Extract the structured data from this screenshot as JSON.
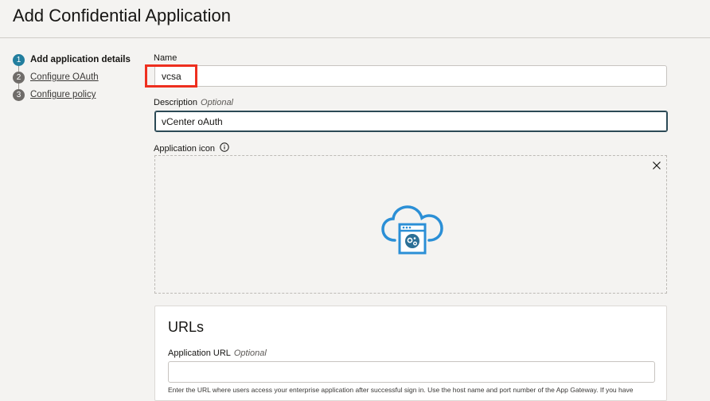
{
  "page": {
    "title": "Add Confidential Application"
  },
  "steps": [
    {
      "number": "1",
      "label": "Add application details",
      "active": true
    },
    {
      "number": "2",
      "label": "Configure OAuth",
      "active": false
    },
    {
      "number": "3",
      "label": "Configure policy",
      "active": false
    }
  ],
  "form": {
    "name": {
      "label": "Name",
      "value": "vcsa"
    },
    "description": {
      "label": "Description",
      "optional": "Optional",
      "value": "vCenter oAuth"
    },
    "application_icon": {
      "label": "Application icon"
    }
  },
  "urls": {
    "title": "URLs",
    "application_url": {
      "label": "Application URL",
      "optional": "Optional",
      "value": ""
    },
    "help_text": "Enter the URL where users access your enterprise application after successful sign in. Use the host name and port number of the App Gateway. If you have"
  },
  "colors": {
    "accent": "#227e9e",
    "highlight": "#ee2f1f",
    "icon_blue": "#2b8fd6"
  },
  "icons": {
    "info": "info-icon",
    "close": "close-icon",
    "app_icon": "cloud-app-icon"
  }
}
